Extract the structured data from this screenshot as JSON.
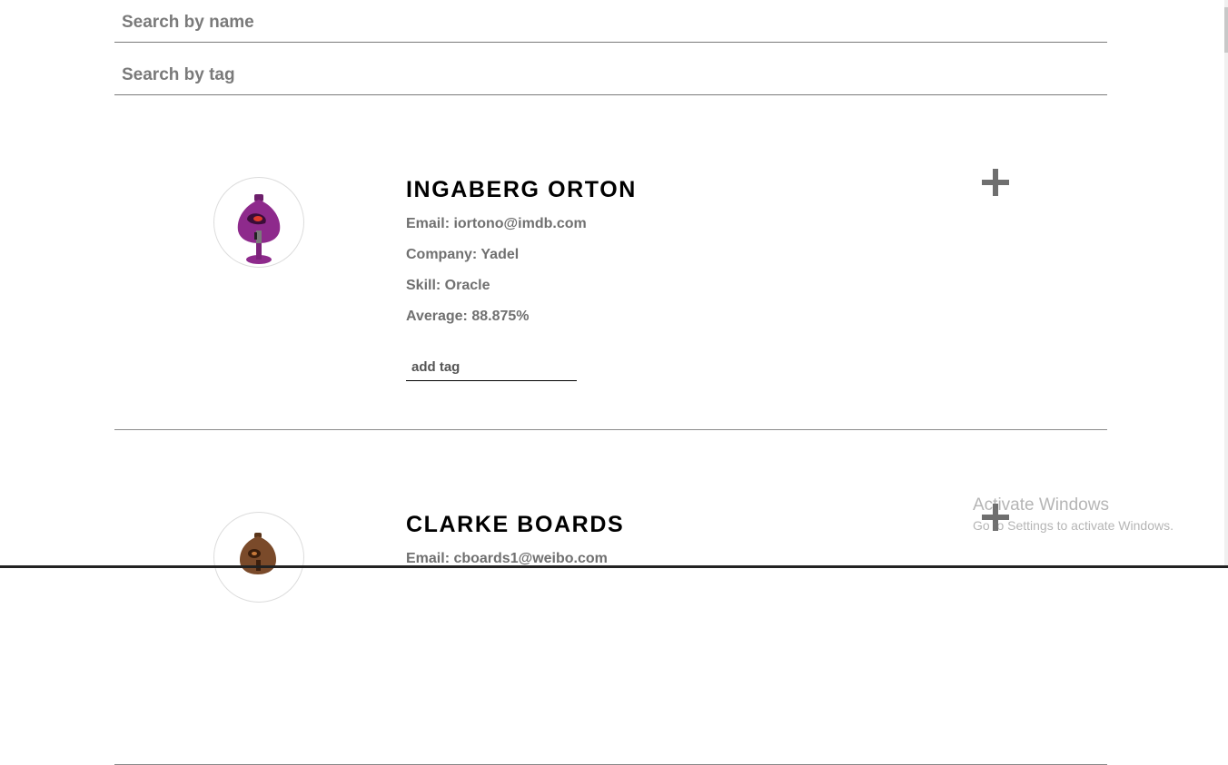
{
  "search": {
    "name_placeholder": "Search by name",
    "tag_placeholder": "Search by tag"
  },
  "students": [
    {
      "name": "INGABERG ORTON",
      "email": "Email: iortono@imdb.com",
      "company": "Company: Yadel",
      "skill": "Skill: Oracle",
      "average": "Average: 88.875%",
      "tag_placeholder": "add tag",
      "avatar": "purple-robot-avatar",
      "expand_icon": "plus-icon"
    },
    {
      "name": "CLARKE BOARDS",
      "email": "Email: cboards1@weibo.com",
      "avatar": "brown-robot-avatar",
      "expand_icon": "plus-icon"
    }
  ],
  "watermark": {
    "title": "Activate Windows",
    "subtitle": "Go to Settings to activate Windows."
  },
  "colors": {
    "name_text": "#000000",
    "detail_text": "#707070",
    "divider": "#8a8a8a",
    "plus_icon": "#6f6f6f",
    "avatar_purple": "#8e2a8c",
    "avatar_brown": "#7a4a2a"
  }
}
